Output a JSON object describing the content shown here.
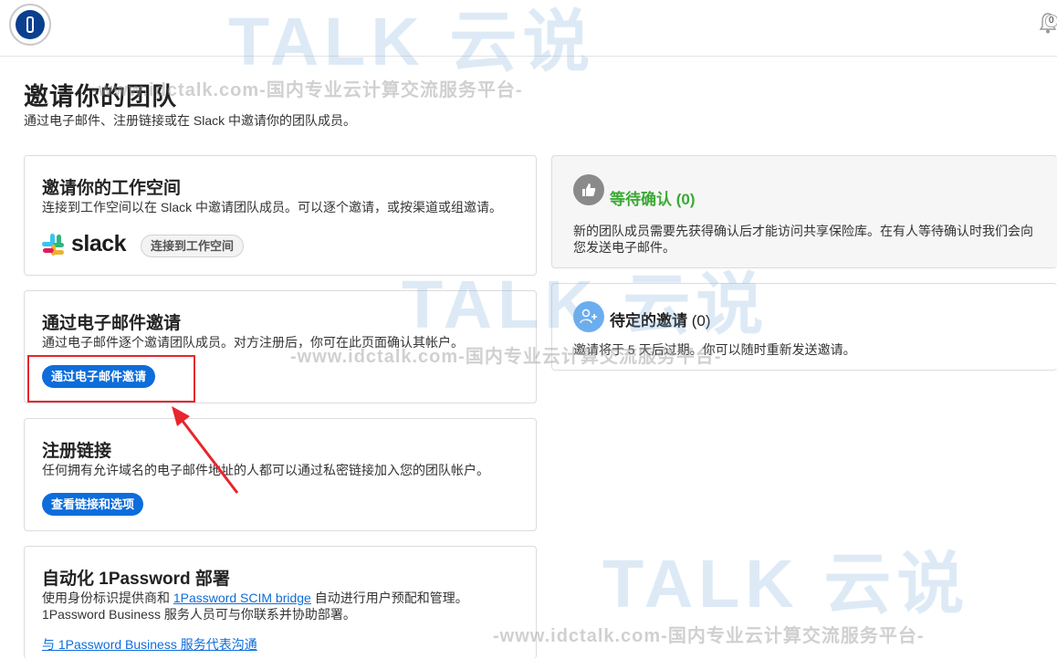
{
  "header": {
    "logo_icon": "1password-logo-icon",
    "notification_icon": "bell-icon",
    "notification_count": "0"
  },
  "page": {
    "title": "邀请你的团队",
    "subtitle": "通过电子邮件、注册链接或在 Slack 中邀请你的团队成员。"
  },
  "workspace_card": {
    "title": "邀请你的工作空间",
    "description": "连接到工作空间以在 Slack 中邀请团队成员。可以逐个邀请，或按渠道或组邀请。",
    "slack_wordmark": "slack",
    "connect_label": "连接到工作空间"
  },
  "email_card": {
    "title": "通过电子邮件邀请",
    "description": "通过电子邮件逐个邀请团队成员。对方注册后，你可在此页面确认其帐户。",
    "button_label": "通过电子邮件邀请"
  },
  "signup_card": {
    "title": "注册链接",
    "description": "任何拥有允许域名的电子邮件地址的人都可以通过私密链接加入您的团队帐户。",
    "button_label": "查看链接和选项"
  },
  "automation_card": {
    "title": "自动化 1Password 部署",
    "description_before": "使用身份标识提供商和 ",
    "scim_link": "1Password SCIM bridge",
    "description_after": " 自动进行用户预配和管理。",
    "description_line2": "1Password Business 服务人员可与你联系并协助部署。",
    "contact_link": "与 1Password Business 服务代表沟通"
  },
  "pending_confirm": {
    "icon": "thumbs-up-icon",
    "title": "等待确认",
    "count": "(0)",
    "description": "新的团队成员需要先获得确认后才能访问共享保险库。在有人等待确认时我们会向您发送电子邮件。"
  },
  "pending_invites": {
    "icon": "add-user-icon",
    "title": "待定的邀请",
    "count": "(0)",
    "description": "邀请将于 5 天后过期。你可以随时重新发送邀请。"
  },
  "watermarks": {
    "brand": "TALK 云说",
    "url": "-www.idctalk.com-国内专业云计算交流服务平台-"
  },
  "colors": {
    "primary_button": "#0d6ddb",
    "confirm_green": "#3aa935",
    "highlight_red": "#e8262c"
  }
}
